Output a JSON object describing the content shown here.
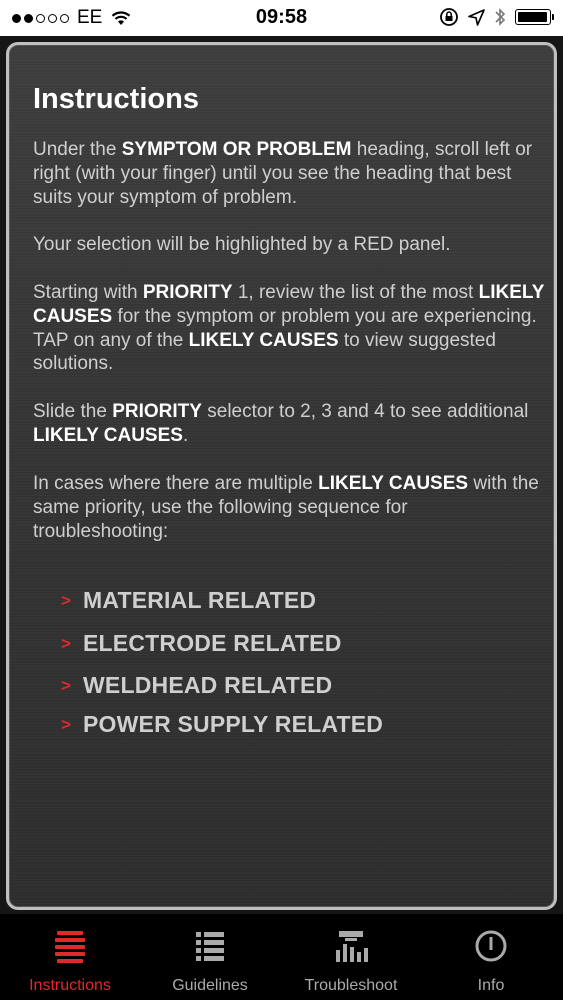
{
  "status_bar": {
    "carrier": "EE",
    "time": "09:58",
    "signal_dots_filled": 2,
    "signal_dots_total": 5,
    "battery_level": 0.95
  },
  "instructions": {
    "title": "Instructions",
    "para1": {
      "a": "Under the ",
      "b": "SYMPTOM OR PROBLEM",
      "c": " heading, scroll left or right (with your finger) until you see the heading that best suits your symptom of problem."
    },
    "para2": "Your selection will be highlighted by a RED panel.",
    "para3": {
      "a": "Starting with ",
      "b": "PRIORITY",
      "c": " 1, review the list of the most ",
      "d": "LIKELY CAUSES",
      "e": " for the symptom or problem you are experiencing. TAP on any of the ",
      "f": "LIKELY CAUSES",
      "g": " to view suggested solutions."
    },
    "para4": {
      "a": "Slide the ",
      "b": "PRIORITY",
      "c": " selector to 2, 3 and 4 to see additional ",
      "d": "LIKELY CAUSES",
      "e": "."
    },
    "para5": {
      "a": "In cases where there are multiple ",
      "b": "LIKELY CAUSES",
      "c": " with the same priority, use the following sequence for troubleshooting:"
    },
    "causes": [
      "MATERIAL RELATED",
      "ELECTRODE RELATED",
      "WELDHEAD RELATED",
      "POWER SUPPLY RELATED"
    ],
    "chevron": ">"
  },
  "tabs": [
    {
      "label": "Instructions",
      "icon": "list-lines-icon",
      "active": true
    },
    {
      "label": "Guidelines",
      "icon": "bulleted-list-icon",
      "active": false
    },
    {
      "label": "Troubleshoot",
      "icon": "equalizer-icon",
      "active": false
    },
    {
      "label": "Info",
      "icon": "power-info-icon",
      "active": false
    }
  ],
  "colors": {
    "accent_red": "#e0292a",
    "panel_bg": "#363636",
    "tab_bar_bg": "#000000"
  }
}
